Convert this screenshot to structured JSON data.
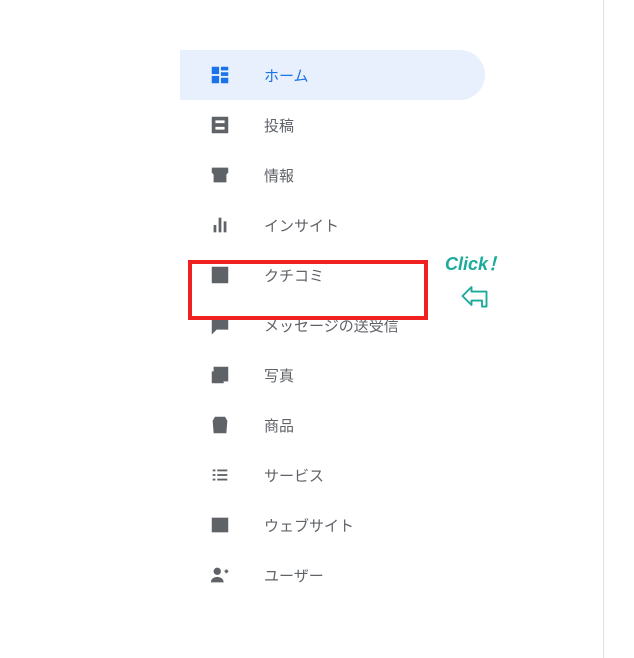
{
  "sidebar": {
    "items": [
      {
        "label": "ホーム",
        "icon": "dashboard-icon",
        "active": true
      },
      {
        "label": "投稿",
        "icon": "post-icon",
        "active": false
      },
      {
        "label": "情報",
        "icon": "store-icon",
        "active": false
      },
      {
        "label": "インサイト",
        "icon": "insights-icon",
        "active": false
      },
      {
        "label": "クチコミ",
        "icon": "review-icon",
        "active": false
      },
      {
        "label": "メッセージの送受信",
        "icon": "message-icon",
        "active": false
      },
      {
        "label": "写真",
        "icon": "photo-icon",
        "active": false
      },
      {
        "label": "商品",
        "icon": "products-icon",
        "active": false
      },
      {
        "label": "サービス",
        "icon": "services-icon",
        "active": false
      },
      {
        "label": "ウェブサイト",
        "icon": "website-icon",
        "active": false
      },
      {
        "label": "ユーザー",
        "icon": "users-icon",
        "active": false
      }
    ]
  },
  "annotation": {
    "click_label": "Click！"
  },
  "colors": {
    "accent": "#1a73e8",
    "active_bg": "#e8f0fe",
    "text_muted": "#5f6368",
    "highlight_border": "#ef2020",
    "annotation": "#1aab9b"
  }
}
